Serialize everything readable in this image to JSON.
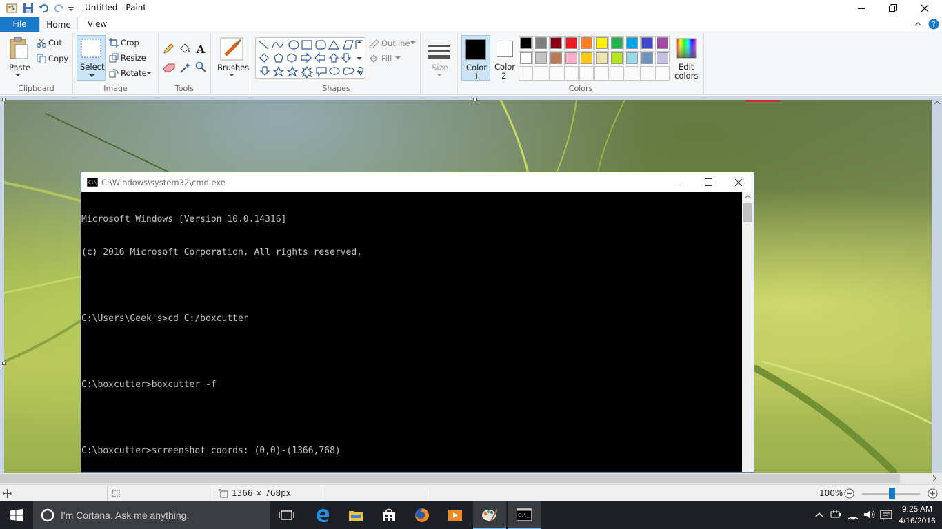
{
  "window": {
    "title": "Untitled - Paint"
  },
  "tabs": [
    {
      "label": "File"
    },
    {
      "label": "Home"
    },
    {
      "label": "View"
    }
  ],
  "ribbon": {
    "clipboard": {
      "group": "Clipboard",
      "paste": "Paste",
      "cut": "Cut",
      "copy": "Copy"
    },
    "image": {
      "group": "Image",
      "select": "Select",
      "crop": "Crop",
      "resize": "Resize",
      "rotate": "Rotate"
    },
    "tools": {
      "group": "Tools"
    },
    "brushes": {
      "label": "Brushes"
    },
    "shapes": {
      "group": "Shapes",
      "outline": "Outline",
      "fill": "Fill"
    },
    "size": {
      "label": "Size"
    },
    "colors": {
      "group": "Colors",
      "color1_line1": "Color",
      "color1_line2": "1",
      "color2_line1": "Color",
      "color2_line2": "2",
      "edit_line1": "Edit",
      "edit_line2": "colors",
      "color1_value": "#000000",
      "color2_value": "#ffffff",
      "palette_row1": [
        "#000000",
        "#7f7f7f",
        "#880015",
        "#ed1c24",
        "#ff7f27",
        "#fff200",
        "#22b14c",
        "#00a2e8",
        "#3f48cc",
        "#a349a4"
      ],
      "palette_row2": [
        "#ffffff",
        "#c3c3c3",
        "#b97a57",
        "#ffaec9",
        "#ffc90e",
        "#efe4b0",
        "#b5e61d",
        "#99d9ea",
        "#7092be",
        "#c8bfe7"
      ]
    }
  },
  "cmd": {
    "title": "C:\\Windows\\system32\\cmd.exe",
    "lines": [
      "Microsoft Windows [Version 10.0.14316]",
      "(c) 2016 Microsoft Corporation. All rights reserved.",
      "",
      "C:\\Users\\Geek's>cd C:/boxcutter",
      "",
      "C:\\boxcutter>boxcutter -f",
      "",
      "C:\\boxcutter>screenshot coords: (0,0)-(1366,768)"
    ]
  },
  "status": {
    "dimensions": "1366 × 768px",
    "zoom": "100%"
  },
  "taskbar": {
    "cortana": "I'm Cortana. Ask me anything.",
    "time": "9:25 AM",
    "date": "4/16/2016"
  }
}
